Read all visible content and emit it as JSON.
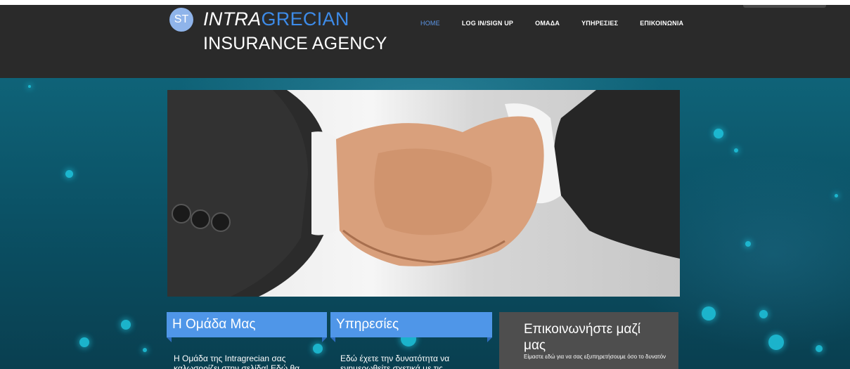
{
  "header": {
    "logo_initials": "ST",
    "brand_emphasis": "INTRA",
    "brand_rest": "GRECIAN",
    "brand_line2": "INSURANCE AGENCY"
  },
  "nav": {
    "items": [
      {
        "label": "HOME",
        "active": true
      },
      {
        "label": "LOG IN/SIGN UP",
        "active": false
      },
      {
        "label": "ΟΜΑΔΑ",
        "active": false
      },
      {
        "label": "ΥΠΗΡΕΣΙΕΣ",
        "active": false
      },
      {
        "label": "ΕΠΙΚΟΙΝΩΝΙΑ",
        "active": false
      }
    ]
  },
  "cards": [
    {
      "title": "Η Ομάδα Μας",
      "text_line1": "Η Ομάδα της  Intragrecian σας",
      "text_line2": "καλωσορίζει στην σελίδα! Εδώ θα"
    },
    {
      "title": "Υπηρεσίες",
      "text_line1": "Εδώ έχετε την δυνατότητα να",
      "text_line2": "ενημερωθείτε σχετικά με τις"
    }
  ],
  "contact": {
    "title": "Επικοινωνήστε μαζί μας",
    "subtitle": "Είμαστε  εδώ για να σας εξυπηρετήσουμε όσο το δυνατόν"
  },
  "colors": {
    "header_bg": "#2a2a2a",
    "accent_blue": "#4f96e8",
    "nav_active": "#5d97e8",
    "page_teal": "#0b5266",
    "contact_bg": "#4e4e4e"
  }
}
